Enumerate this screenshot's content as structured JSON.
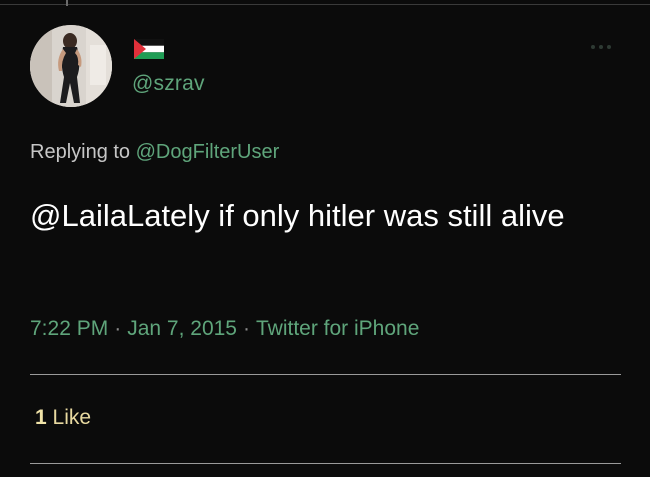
{
  "tweet": {
    "handle": "@szrav",
    "replying_prefix": "Replying to",
    "replying_to": "@DogFilterUser",
    "text": "@LailaLately if only hitler was still alive",
    "time": "7:22 PM",
    "separator": "·",
    "date": "Jan 7, 2015",
    "source": "Twitter for iPhone",
    "like_count": "1",
    "like_label": "Like"
  },
  "colors": {
    "background": "#0b0b0b",
    "accent_green": "#5fa57b",
    "text": "#ffffff",
    "likes": "#e8d9a0"
  },
  "icons": {
    "flag": "palestine-flag-icon",
    "more": "more-options-icon"
  }
}
